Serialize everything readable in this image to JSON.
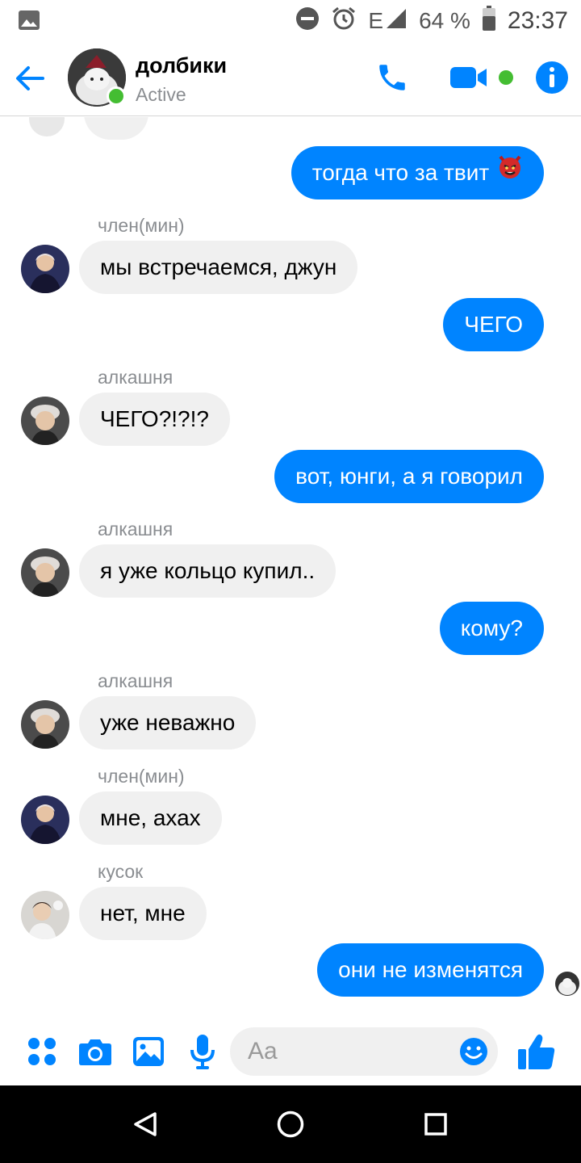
{
  "status_bar": {
    "network": "E",
    "battery": "64 %",
    "time": "23:37"
  },
  "header": {
    "title": "долбики",
    "status": "Active"
  },
  "messages": [
    {
      "direction": "out",
      "text": "тогда что за твит"
    },
    {
      "direction": "in",
      "sender": "член(мин)",
      "text": "мы встречаемся, джун"
    },
    {
      "direction": "out",
      "text": "ЧЕГО"
    },
    {
      "direction": "in",
      "sender": "алкашня",
      "text": "ЧЕГО?!?!?"
    },
    {
      "direction": "out",
      "text": "вот, юнги, а я говорил"
    },
    {
      "direction": "in",
      "sender": "алкашня",
      "text": "я уже кольцо купил.."
    },
    {
      "direction": "out",
      "text": "кому?"
    },
    {
      "direction": "in",
      "sender": "алкашня",
      "text": "уже неважно"
    },
    {
      "direction": "in",
      "sender": "член(мин)",
      "text": "мне, ахах"
    },
    {
      "direction": "in",
      "sender": "кусок",
      "text": "нет, мне"
    },
    {
      "direction": "out",
      "text": "они не изменятся"
    }
  ],
  "composer": {
    "placeholder": "Aa"
  },
  "colors": {
    "accent": "#0084ff",
    "incoming_bubble": "#f0f0f0",
    "presence": "#44bd32"
  }
}
